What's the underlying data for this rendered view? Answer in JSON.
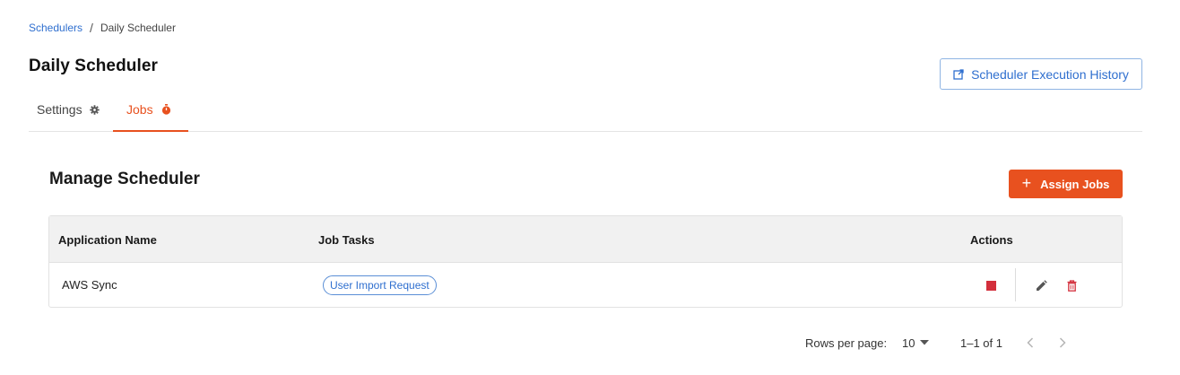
{
  "breadcrumb": {
    "parent": "Schedulers",
    "separator": "/",
    "current": "Daily Scheduler"
  },
  "page": {
    "title": "Daily Scheduler"
  },
  "header_actions": {
    "history_label": "Scheduler Execution History",
    "history_icon": "external-link-icon"
  },
  "tabs": [
    {
      "label": "Settings",
      "icon": "gear-icon",
      "active": false
    },
    {
      "label": "Jobs",
      "icon": "timer-icon",
      "active": true
    }
  ],
  "section": {
    "title": "Manage Scheduler",
    "assign_label": "Assign Jobs",
    "assign_icon": "plus-icon"
  },
  "table": {
    "columns": [
      "Application Name",
      "Job Tasks",
      "Actions"
    ],
    "rows": [
      {
        "application": "AWS Sync",
        "job_task": "User Import Request",
        "actions": [
          "stop-icon",
          "edit-icon",
          "delete-icon"
        ]
      }
    ]
  },
  "pagination": {
    "rows_per_page_label": "Rows per page:",
    "rows_per_page": "10",
    "range": "1–1 of 1"
  },
  "colors": {
    "accent": "#e8511f",
    "link": "#2f6fcf",
    "danger": "#d32f3c"
  }
}
